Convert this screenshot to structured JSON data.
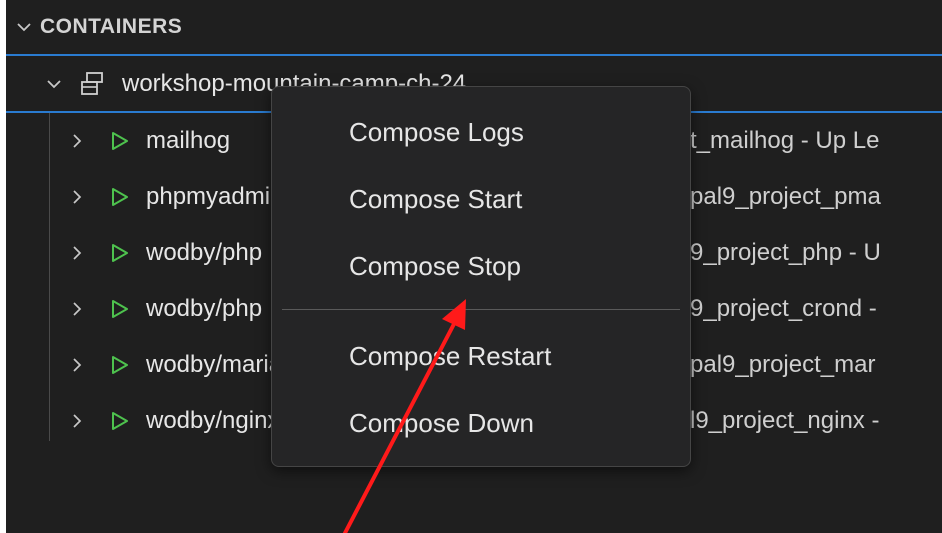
{
  "section": {
    "title": "CONTAINERS"
  },
  "group": {
    "label": "workshop-mountain-camp-ch-24"
  },
  "containers": [
    {
      "name": "mailhog",
      "desc": "t_mailhog - Up Le"
    },
    {
      "name": "phpmyadmin",
      "desc": "pal9_project_pma"
    },
    {
      "name": "wodby/php",
      "desc": "9_project_php - U"
    },
    {
      "name": "wodby/php",
      "desc": "9_project_crond -"
    },
    {
      "name": "wodby/mariadb",
      "desc": "pal9_project_mar"
    },
    {
      "name": "wodby/nginx",
      "desc": "l9_project_nginx -"
    }
  ],
  "context_menu": {
    "items": [
      {
        "label": "Compose Logs"
      },
      {
        "label": "Compose Start"
      },
      {
        "label": "Compose Stop"
      },
      {
        "label": "Compose Restart"
      },
      {
        "label": "Compose Down"
      }
    ]
  },
  "colors": {
    "panel_bg": "#1f1f1f",
    "focus_border": "#2a7bd0",
    "running_icon": "#4ec24e",
    "menu_bg": "#252526",
    "annotation_arrow": "#ff1a1a"
  },
  "icons": {
    "section_chevron": "chevron-down-icon",
    "group_chevron": "chevron-down-icon",
    "group_icon": "stack-icon",
    "row_chevron": "chevron-right-icon",
    "row_status": "play-icon"
  }
}
